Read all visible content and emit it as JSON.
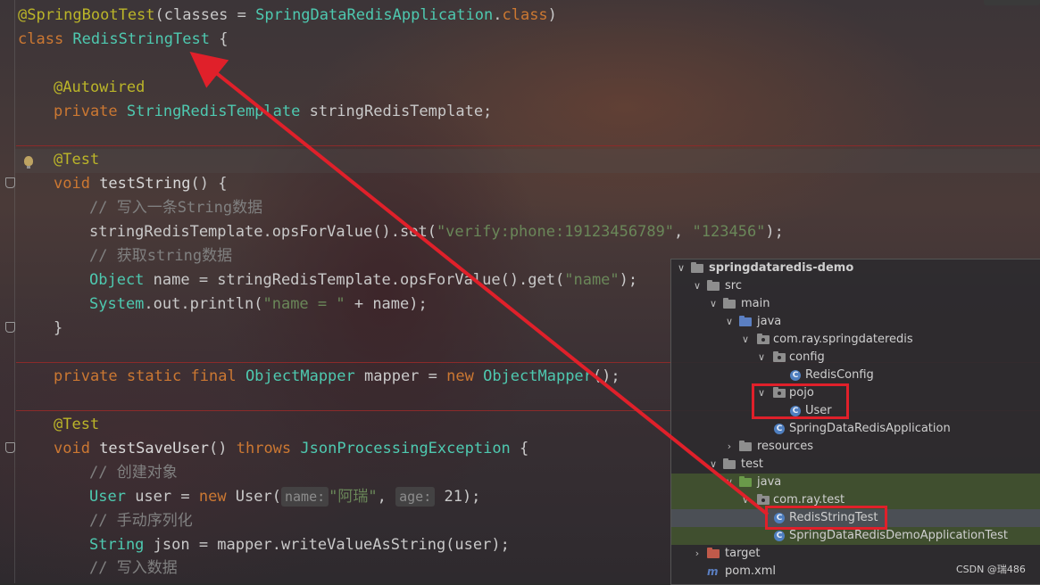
{
  "editor": {
    "lines": {
      "l1": [
        "@SpringBootTest",
        "(classes = ",
        "SpringDataRedisApplication",
        ".",
        "class",
        ")"
      ],
      "l2": [
        "class ",
        "RedisStringTest",
        " {"
      ],
      "l3": [
        "@Autowired"
      ],
      "l4": [
        "private ",
        "StringRedisTemplate",
        " stringRedisTemplate;"
      ],
      "l5": [
        "@Test"
      ],
      "l6": [
        "void ",
        "testString",
        "() {"
      ],
      "l7": [
        "// 写入一条String数据"
      ],
      "l8": [
        "stringRedisTemplate.opsForValue().set(",
        "\"verify:phone:19123456789\"",
        ", ",
        "\"123456\"",
        ");"
      ],
      "l9": [
        "// 获取string数据"
      ],
      "l10": [
        "Object",
        " name = stringRedisTemplate.opsForValue().get(",
        "\"name\"",
        ");"
      ],
      "l11": [
        "System",
        ".out.println(",
        "\"name = \"",
        " + name);"
      ],
      "l12": [
        "}"
      ],
      "l13": [
        "private static final ",
        "ObjectMapper",
        " mapper = ",
        "new ",
        "ObjectMapper",
        "();"
      ],
      "l14": [
        "@Test"
      ],
      "l15": [
        "void ",
        "testSaveUser",
        "() ",
        "throws ",
        "JsonProcessingException",
        " {"
      ],
      "l16": [
        "// 创建对象"
      ],
      "l17": [
        "User",
        " user = ",
        "new ",
        "User(",
        "name:",
        "\"阿瑞\"",
        ", ",
        "age:",
        " 21);"
      ],
      "l18": [
        "// 手动序列化"
      ],
      "l19": [
        "String",
        " json = mapper.writeValueAsString(user);"
      ],
      "l20": [
        "// 写入数据"
      ]
    }
  },
  "project_tree": {
    "items": [
      {
        "label": "springdataredis-demo",
        "icon": "module-folder-icon"
      },
      {
        "label": "src",
        "icon": "folder-icon"
      },
      {
        "label": "main",
        "icon": "folder-icon"
      },
      {
        "label": "java",
        "icon": "source-folder-icon"
      },
      {
        "label": "com.ray.springdateredis",
        "icon": "package-icon"
      },
      {
        "label": "config",
        "icon": "package-icon"
      },
      {
        "label": "RedisConfig",
        "icon": "class-icon"
      },
      {
        "label": "pojo",
        "icon": "package-icon"
      },
      {
        "label": "User",
        "icon": "class-icon"
      },
      {
        "label": "SpringDataRedisApplication",
        "icon": "spring-class-icon"
      },
      {
        "label": "resources",
        "icon": "resources-folder-icon"
      },
      {
        "label": "test",
        "icon": "folder-icon"
      },
      {
        "label": "java",
        "icon": "test-source-folder-icon"
      },
      {
        "label": "com.ray.test",
        "icon": "package-icon"
      },
      {
        "label": "RedisStringTest",
        "icon": "class-icon"
      },
      {
        "label": "SpringDataRedisDemoApplicationTest",
        "icon": "spring-class-icon"
      },
      {
        "label": "target",
        "icon": "excluded-folder-icon"
      },
      {
        "label": "pom.xml",
        "icon": "maven-icon"
      }
    ]
  },
  "watermark": "CSDN @瑞486",
  "colors": {
    "annotation": "#bbb529",
    "keyword": "#cc7832",
    "type": "#4ec9b0",
    "string": "#6a8759",
    "comment": "#808080",
    "highlight_box": "#e0202a",
    "arrow": "#e0202a"
  }
}
